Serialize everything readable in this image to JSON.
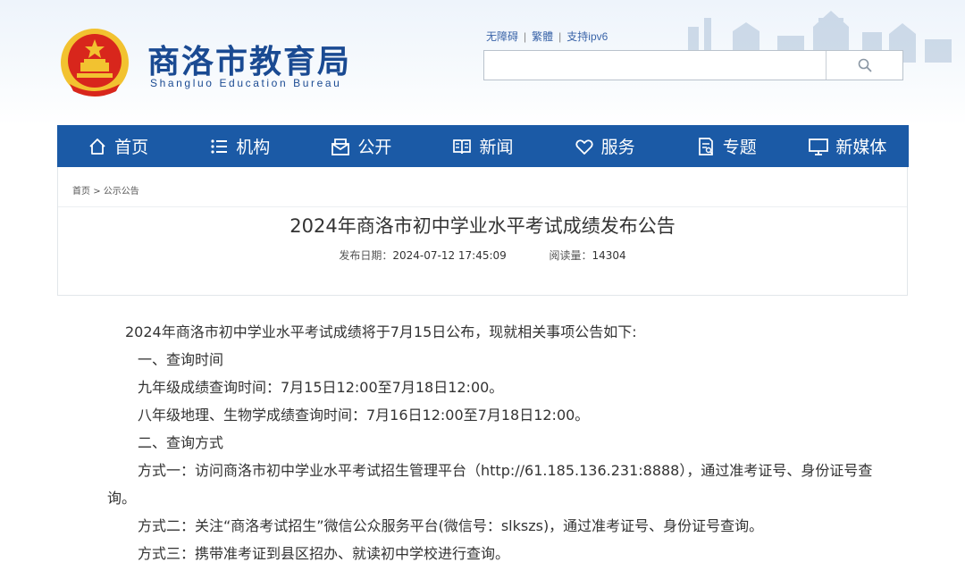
{
  "header": {
    "site_name_cn": "商洛市教育局",
    "site_name_en": "Shangluo Education Bureau",
    "links": [
      "无障碍",
      "繁體",
      "支持ipv6"
    ],
    "search_placeholder": ""
  },
  "nav": {
    "items": [
      {
        "label": "首页",
        "icon": "home-icon"
      },
      {
        "label": "机构",
        "icon": "list-icon"
      },
      {
        "label": "公开",
        "icon": "envelope-icon"
      },
      {
        "label": "新闻",
        "icon": "book-icon"
      },
      {
        "label": "服务",
        "icon": "heart-icon"
      },
      {
        "label": "专题",
        "icon": "document-icon"
      },
      {
        "label": "新媒体",
        "icon": "monitor-icon"
      }
    ]
  },
  "breadcrumb": {
    "home": "首页",
    "sep": ">",
    "current": "公示公告"
  },
  "article": {
    "title": "2024年商洛市初中学业水平考试成绩发布公告",
    "date_label": "发布日期：",
    "date_value": "2024-07-12 17:45:09",
    "views_label": "阅读量：",
    "views_value": "14304",
    "paragraphs": [
      "2024年商洛市初中学业水平考试成绩将于7月15日公布，现就相关事项公告如下:",
      "一、查询时间",
      "九年级成绩查询时间：7月15日12:00至7月18日12:00。",
      "八年级地理、生物学成绩查询时间：7月16日12:00至7月18日12:00。",
      "二、查询方式",
      "方式一：访问商洛市初中学业水平考试招生管理平台（http://61.185.136.231:8888），通过准考证号、身份证号查询。",
      "方式二：关注“商洛考试招生”微信公众服务平台(微信号：slkszs)，通过准考证号、身份证号查询。",
      "方式三：携带准考证到县区招办、就读初中学校进行查询。"
    ]
  },
  "colors": {
    "nav_bg": "#1b5aa6",
    "brand_blue": "#1a4a92",
    "emblem_red": "#d8261c",
    "emblem_gold": "#f2c230"
  }
}
